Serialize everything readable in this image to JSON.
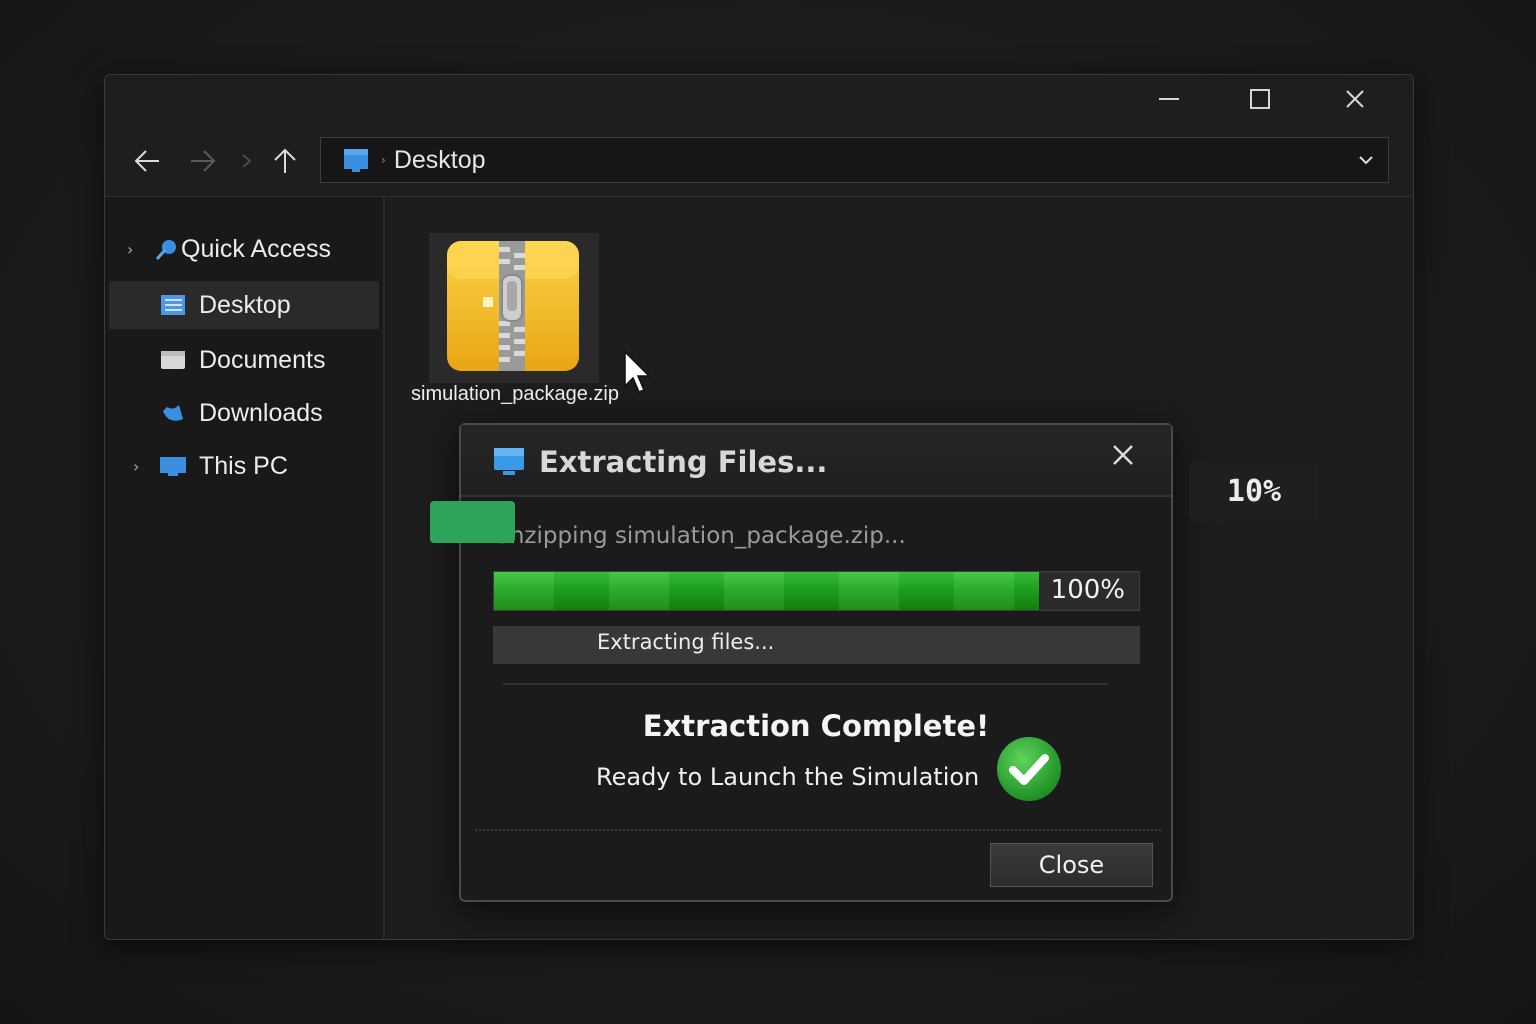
{
  "window": {
    "controls": {
      "minimize": "minimize",
      "maximize": "maximize",
      "close": "close"
    }
  },
  "toolbar": {
    "address_path": "Desktop",
    "nav": {
      "back": "back",
      "forward": "forward",
      "up": "up"
    }
  },
  "sidebar": {
    "items": [
      {
        "label": "Quick Access",
        "icon": "quick-access-icon",
        "expandable": true,
        "selected": false
      },
      {
        "label": "Desktop",
        "icon": "desktop-icon",
        "expandable": false,
        "selected": true
      },
      {
        "label": "Documents",
        "icon": "documents-icon",
        "expandable": false,
        "selected": false
      },
      {
        "label": "Downloads",
        "icon": "downloads-icon",
        "expandable": false,
        "selected": false
      },
      {
        "label": "This PC",
        "icon": "this-pc-icon",
        "expandable": true,
        "selected": false
      }
    ]
  },
  "content": {
    "files": [
      {
        "name": "simulation_package.zip",
        "icon": "zip-archive-icon"
      }
    ]
  },
  "dialog": {
    "title": "Extracting Files...",
    "status": "Unzipping simulation_package.zip...",
    "progress_value": 100,
    "progress_label": "100%",
    "sub_status": "Extracting files...",
    "complete_title": "Extraction Complete!",
    "complete_subtitle": "Ready to Launch the Simulation",
    "close_button": "Close"
  },
  "overlay_badge": "10%",
  "colors": {
    "progress_green": "#1fa61f",
    "check_green": "#2fae3a",
    "accent_blue": "#3a8fe0",
    "zip_yellow": "#f2b51d"
  }
}
